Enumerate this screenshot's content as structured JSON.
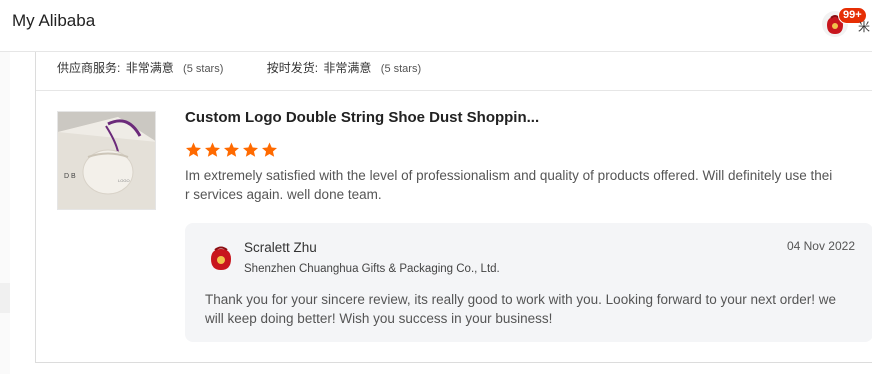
{
  "header": {
    "title": "My Alibaba",
    "notification_count": "99+",
    "cut_glyph": "米"
  },
  "ratings": [
    {
      "label": "供应商服务:",
      "value": "非常满意",
      "stars": "(5 stars)"
    },
    {
      "label": "按时发货:",
      "value": "非常满意",
      "stars": "(5 stars)"
    }
  ],
  "review": {
    "product_title": "Custom Logo Double String Shoe Dust Shoppin...",
    "rating": 5,
    "max_rating": 5,
    "text": "Im extremely satisfied with the level of professionalism and quality of products offered. Will definitely use their services again. well done team."
  },
  "reply": {
    "name": "Scralett Zhu",
    "company": "Shenzhen Chuanghua Gifts & Packaging Co., Ltd.",
    "date": "04 Nov 2022",
    "text": "Thank you for your sincere review, its really good to work with you. Looking forward to your next order! we will keep doing better! Wish you success in your business!"
  },
  "colors": {
    "star": "#ff6a00",
    "badge": "#e62e04",
    "reply_bg": "#f4f5f7"
  }
}
